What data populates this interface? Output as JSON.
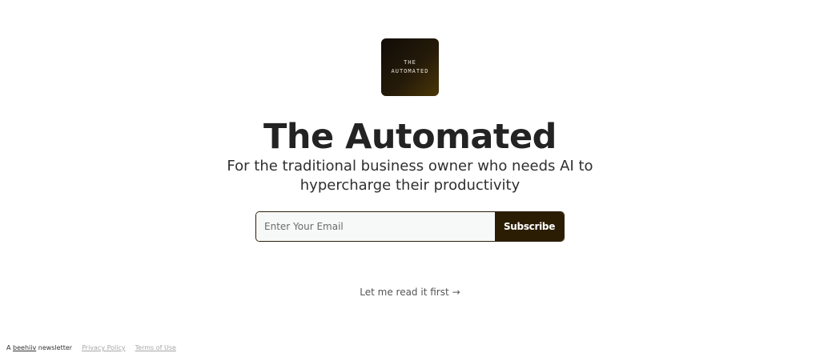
{
  "logo": {
    "line1": "THE",
    "line2": "AUTOMATED"
  },
  "hero": {
    "title": "The Automated",
    "subtitle": "For the traditional business owner who needs AI to hypercharge their productivity"
  },
  "signup": {
    "email_placeholder": "Enter Your Email",
    "subscribe_label": "Subscribe"
  },
  "read_first": {
    "label": "Let me read it first",
    "arrow": "→"
  },
  "footer": {
    "prefix": "A",
    "brand_link": "beehiiv",
    "suffix": "newsletter",
    "privacy_link": "Privacy Policy",
    "terms_link": "Terms of Use"
  },
  "colors": {
    "accent": "#2b1d04",
    "text": "#232323",
    "muted": "#a6a6a6"
  }
}
